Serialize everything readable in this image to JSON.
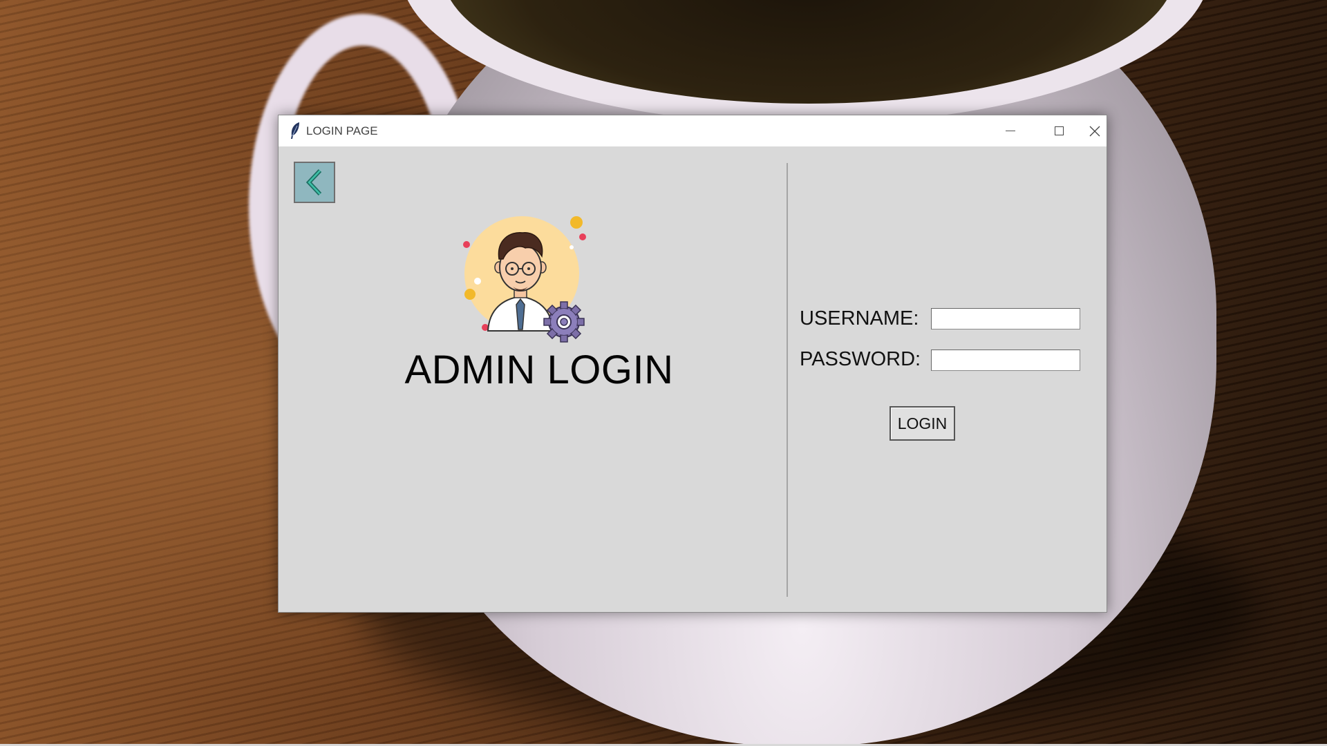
{
  "window": {
    "title": "LOGIN PAGE",
    "app_icon": "feather-icon",
    "controls": [
      "minimize-icon",
      "maximize-icon",
      "close-icon"
    ]
  },
  "left_panel": {
    "back_icon": "chevron-left-icon",
    "avatar": "admin-avatar-with-gear",
    "heading": "ADMIN LOGIN"
  },
  "form": {
    "username_label": "USERNAME:",
    "username_value": "",
    "password_label": "PASSWORD:",
    "password_value": "",
    "login_label": "LOGIN"
  },
  "colors": {
    "window_bg": "#d9d9d9",
    "titlebar_bg": "#ffffff",
    "back_button_bg": "#8fb7bf",
    "avatar_circle": "#fcdc9c",
    "gear": "#7d6fa8"
  }
}
